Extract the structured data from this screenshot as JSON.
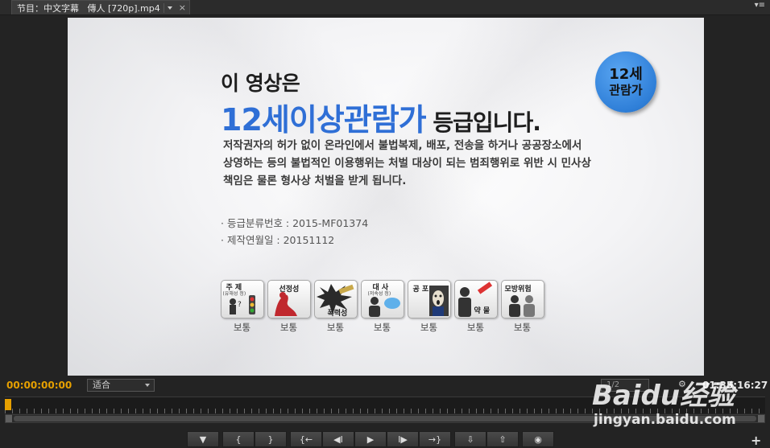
{
  "panel": {
    "tab_title": "节目：中文字幕   傳人 [720p].mp4",
    "close_glyph": "×",
    "menu_glyph": "▾≡"
  },
  "video": {
    "line1": "이 영상은",
    "rating_big": "12세이상관람가",
    "rating_suffix": " 등급입니다.",
    "paragraph": "저작권자의 허가 없이 온라인에서 불법복제, 배포, 전송을 하거나 공공장소에서 상영하는 등의 불법적인 이용행위는 처벌 대상이 되는 범죄행위로 위반 시 민사상 책임은 물론 형사상 처벌을 받게 됩니다.",
    "info_number": "· 등급분류번호 : 2015-MF01374",
    "info_date": "· 제작연월일 : 20151112",
    "badge_num": "12세",
    "badge_text": "관람가",
    "icons": [
      {
        "name": "주 제",
        "sub": "(유해성 정)",
        "rating": "보통",
        "icon": "theme-icon"
      },
      {
        "name": "선정성",
        "sub": "",
        "rating": "보통",
        "icon": "sexuality-icon"
      },
      {
        "name": "폭력성",
        "sub": "",
        "rating": "보통",
        "icon": "violence-icon"
      },
      {
        "name": "대 사",
        "sub": "(저속성 정)",
        "rating": "보통",
        "icon": "dialogue-icon"
      },
      {
        "name": "공 포",
        "sub": "",
        "rating": "보통",
        "icon": "horror-icon"
      },
      {
        "name": "약 물",
        "sub": "",
        "rating": "보통",
        "icon": "drug-icon"
      },
      {
        "name": "모방위험",
        "sub": "",
        "rating": "보통",
        "icon": "imitation-icon"
      }
    ]
  },
  "controls": {
    "timecode_left": "00:00:00:00",
    "fit": "适合",
    "resolution": "1/2",
    "timecode_right": "01:35:16:27",
    "buttons": [
      "▼",
      "{",
      "}",
      "{←",
      "◀I",
      "▶",
      "I▶",
      "→}",
      "⇩",
      "⇧",
      "◉"
    ],
    "add_glyph": "+"
  },
  "watermark": {
    "logo": "Baidu经验",
    "url": "jingyan.baidu.com"
  },
  "colors": {
    "accent_timecode": "#e6a000",
    "rating_blue": "#2f6fd6"
  }
}
